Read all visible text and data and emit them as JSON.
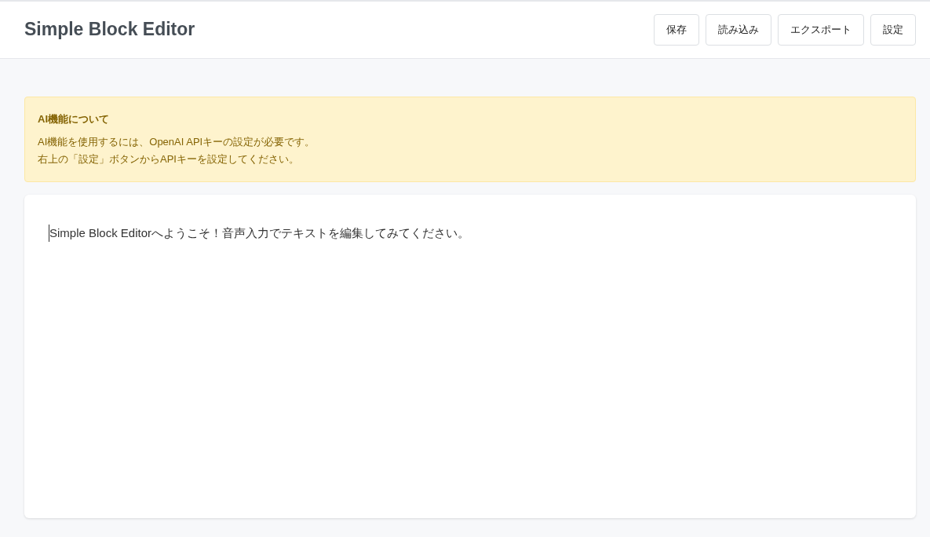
{
  "header": {
    "title": "Simple Block Editor",
    "buttons": [
      "保存",
      "読み込み",
      "エクスポート",
      "設定"
    ]
  },
  "notice": {
    "title": "AI機能について",
    "lines": [
      "AI機能を使用するには、OpenAI APIキーの設定が必要です。",
      "右上の「設定」ボタンからAPIキーを設定してください。"
    ]
  },
  "editor": {
    "blocks": [
      "Simple Block Editorへようこそ！音声入力でテキストを編集してみてください。"
    ]
  }
}
